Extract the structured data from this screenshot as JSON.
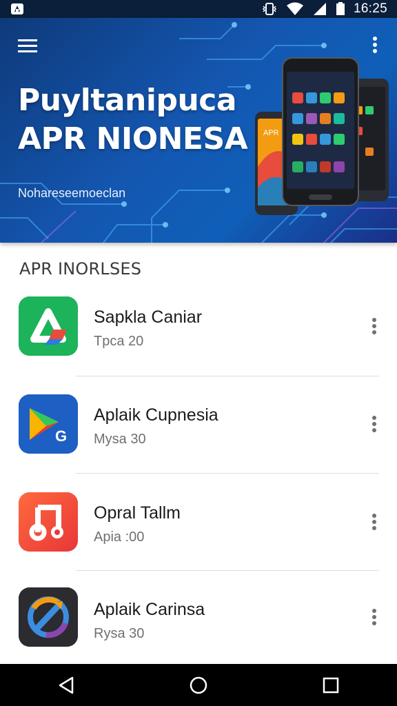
{
  "status_bar": {
    "time": "16:25",
    "icons": [
      "notification-icon",
      "vibrate-icon",
      "wifi-icon",
      "signal-icon",
      "battery-icon"
    ]
  },
  "hero": {
    "title_line1": "Puyltanipuca",
    "title_line2": "APR NIONESA",
    "subtitle": "Nohareseemoeclan",
    "phone_label": "APR",
    "colors": {
      "gradient_start": "#0e3a7a",
      "gradient_end": "#1a2f86"
    }
  },
  "section": {
    "title": "APR INORLSES"
  },
  "apps": [
    {
      "name": "Sapkla Caniar",
      "meta": "Tpca 20",
      "icon": "triangle-logo-icon",
      "icon_color": "#1db35a"
    },
    {
      "name": "Aplaik Cupnesia",
      "meta": "Mysa 30",
      "icon": "play-g-logo-icon",
      "icon_color": "#1e5fc4"
    },
    {
      "name": "Opral Tallm",
      "meta": "Apia :00",
      "icon": "music-note-logo-icon",
      "icon_color": "#f04a2e"
    },
    {
      "name": "Aplaik Carinsa",
      "meta": "Rysa 30",
      "icon": "swirl-logo-icon",
      "icon_color": "#2b2b30"
    }
  ],
  "nav": {
    "buttons": [
      "back-icon",
      "home-icon",
      "recents-icon"
    ]
  }
}
